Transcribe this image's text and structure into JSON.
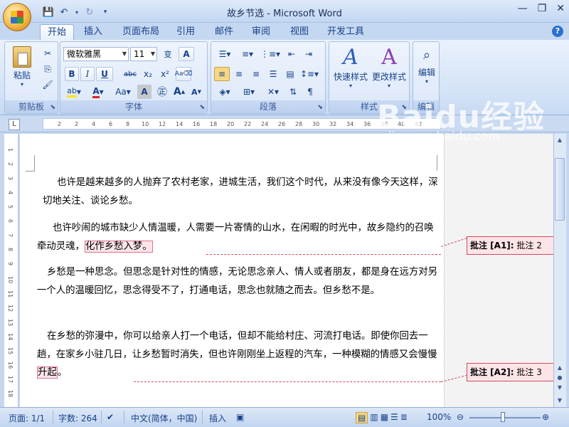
{
  "window": {
    "title": "故乡节选 - Microsoft Word"
  },
  "tabs": [
    "开始",
    "插入",
    "页面布局",
    "引用",
    "邮件",
    "审阅",
    "视图",
    "开发工具"
  ],
  "active_tab": "开始",
  "ribbon": {
    "clipboard": {
      "label": "剪贴板",
      "paste": "粘贴"
    },
    "font": {
      "label": "字体",
      "font_name": "微软雅黑",
      "font_size": "11",
      "bold": "B",
      "italic": "I",
      "underline": "U",
      "strike": "abc",
      "sub": "x₂",
      "sup": "x²",
      "case": "Aa",
      "grow": "A",
      "shrink": "A"
    },
    "paragraph": {
      "label": "段落"
    },
    "styles": {
      "label": "样式",
      "quick": "快速样式",
      "change": "更改样式"
    },
    "editing": {
      "label": "编辑",
      "edit": "编辑"
    }
  },
  "ruler": {
    "ticks": [
      "2",
      "2",
      "4",
      "6",
      "8",
      "10",
      "12",
      "14",
      "16",
      "18",
      "20",
      "22",
      "24",
      "26",
      "28",
      "30",
      "32",
      "34",
      "36",
      "38",
      "40",
      "42",
      "44",
      "46"
    ]
  },
  "vruler": {
    "ticks": [
      "1",
      "2",
      "3",
      "4",
      "5",
      "6",
      "7",
      "8",
      "9",
      "10",
      "11",
      "12",
      "13",
      "14",
      "15",
      "16",
      "17",
      "18"
    ]
  },
  "document": {
    "paragraphs": [
      {
        "text": "也许是越来越多的人抛弃了农村老家，进城生活，我们这个时代，从来没有像今天这样，深切地关注、谈论乡愁。"
      },
      {
        "text_before": "也许吵闹的城市缺少人情温暖，人需要一片寄情的山水，在闲暇的时光中，故乡隐约的召唤牵动灵魂，",
        "highlight": "化作乡愁入梦。"
      },
      {
        "text": "乡愁是一种思念。但思念是针对性的情感，无论思念亲人、情人或者朋友，都是身在远方对另一个人的温暖回忆，思念得受不了，打通电话，思念也就随之而去。但乡愁不是。"
      },
      {
        "text_before": "在乡愁的弥漫中，你可以给亲人打一个电话，但却不能给村庄、河流打电话。即使你回去一趟，在家乡小驻几日，让乡愁暂时消失，但也许刚刚坐上返程的汽车，一种模糊的情感又会慢慢",
        "highlight": "升起",
        "text_after": "。"
      }
    ]
  },
  "comments": [
    {
      "label": "批注 [A1]:",
      "text": "批注 2"
    },
    {
      "label": "批注 [A2]:",
      "text": "批注 3"
    }
  ],
  "statusbar": {
    "page": "页面: 1/1",
    "words": "字数: 264",
    "language": "中文(简体，中国)",
    "mode": "插入",
    "zoom": "100%"
  },
  "watermark": {
    "brand": "Baidu经验",
    "url": "jingyan.baidu.com"
  }
}
